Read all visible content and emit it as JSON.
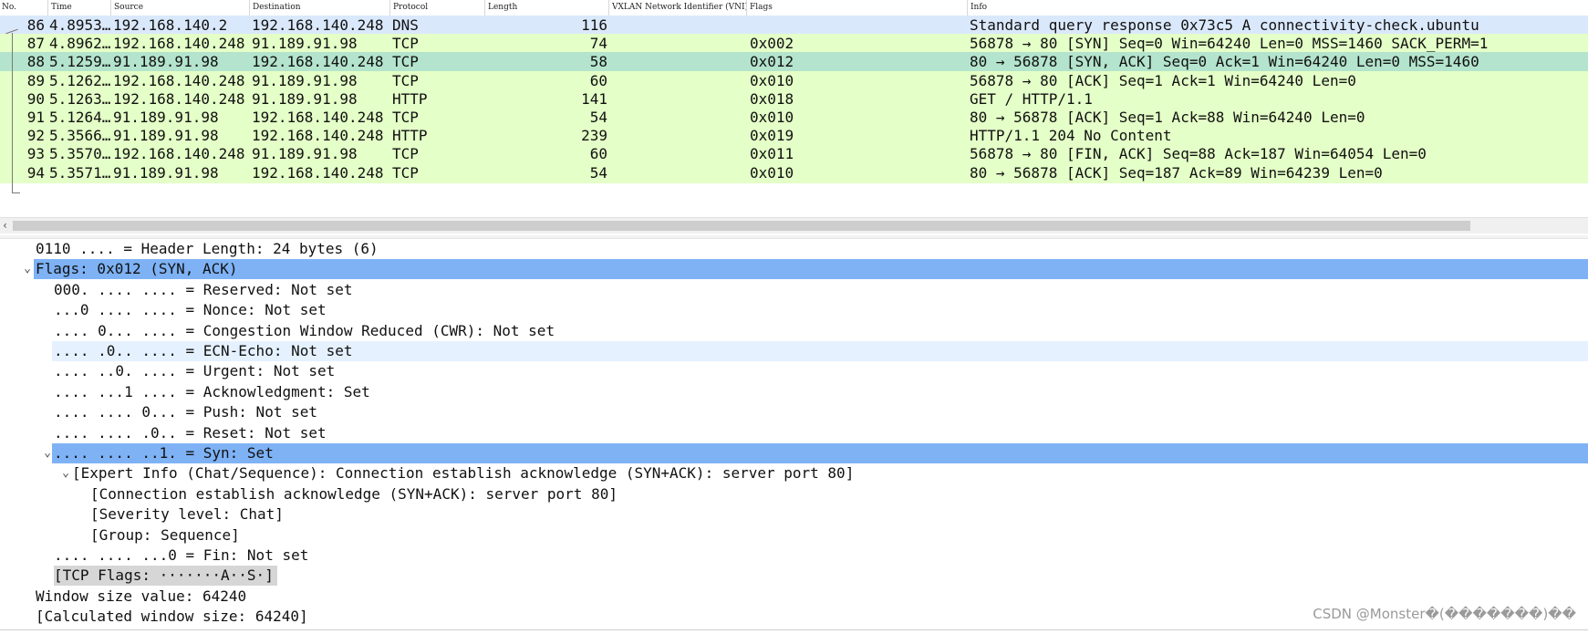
{
  "packet_list": {
    "columns": [
      "No.",
      "Time",
      "Source",
      "Destination",
      "Protocol",
      "Length",
      "VXLAN Network Identifier (VNI)",
      "Flags",
      "Info"
    ],
    "rows": [
      {
        "no": "86",
        "time": "4.8953…",
        "src": "192.168.140.2",
        "dst": "192.168.140.248",
        "proto": "DNS",
        "len": "116",
        "vni": "",
        "flags": "",
        "info": "Standard query response 0x73c5 A connectivity-check.ubuntu"
      },
      {
        "no": "87",
        "time": "4.8962…",
        "src": "192.168.140.248",
        "dst": "91.189.91.98",
        "proto": "TCP",
        "len": "74",
        "vni": "",
        "flags": "0x002",
        "info": "56878 → 80 [SYN] Seq=0 Win=64240 Len=0 MSS=1460 SACK_PERM=1"
      },
      {
        "no": "88",
        "time": "5.1259…",
        "src": "91.189.91.98",
        "dst": "192.168.140.248",
        "proto": "TCP",
        "len": "58",
        "vni": "",
        "flags": "0x012",
        "info": "80 → 56878 [SYN, ACK] Seq=0 Ack=1 Win=64240 Len=0 MSS=1460"
      },
      {
        "no": "89",
        "time": "5.1262…",
        "src": "192.168.140.248",
        "dst": "91.189.91.98",
        "proto": "TCP",
        "len": "60",
        "vni": "",
        "flags": "0x010",
        "info": "56878 → 80 [ACK] Seq=1 Ack=1 Win=64240 Len=0"
      },
      {
        "no": "90",
        "time": "5.1263…",
        "src": "192.168.140.248",
        "dst": "91.189.91.98",
        "proto": "HTTP",
        "len": "141",
        "vni": "",
        "flags": "0x018",
        "info": "GET / HTTP/1.1"
      },
      {
        "no": "91",
        "time": "5.1264…",
        "src": "91.189.91.98",
        "dst": "192.168.140.248",
        "proto": "TCP",
        "len": "54",
        "vni": "",
        "flags": "0x010",
        "info": "80 → 56878 [ACK] Seq=1 Ack=88 Win=64240 Len=0"
      },
      {
        "no": "92",
        "time": "5.3566…",
        "src": "91.189.91.98",
        "dst": "192.168.140.248",
        "proto": "HTTP",
        "len": "239",
        "vni": "",
        "flags": "0x019",
        "info": "HTTP/1.1 204 No Content"
      },
      {
        "no": "93",
        "time": "5.3570…",
        "src": "192.168.140.248",
        "dst": "91.189.91.98",
        "proto": "TCP",
        "len": "60",
        "vni": "",
        "flags": "0x011",
        "info": "56878 → 80 [FIN, ACK] Seq=88 Ack=187 Win=64054 Len=0"
      },
      {
        "no": "94",
        "time": "5.3571…",
        "src": "91.189.91.98",
        "dst": "192.168.140.248",
        "proto": "TCP",
        "len": "54",
        "vni": "",
        "flags": "0x010",
        "info": "80 → 56878 [ACK] Seq=187 Ack=89 Win=64239 Len=0"
      }
    ],
    "row_colors": {
      "dns": "#dae8fc",
      "tcp": "#e4ffc7",
      "selected": "#b4e4cd"
    }
  },
  "details": [
    {
      "text": "0110 .... = Header Length: 24 bytes (6)"
    },
    {
      "text": "Flags: 0x012 (SYN, ACK)"
    },
    {
      "text": "000. .... .... = Reserved: Not set"
    },
    {
      "text": "...0 .... .... = Nonce: Not set"
    },
    {
      "text": ".... 0... .... = Congestion Window Reduced (CWR): Not set"
    },
    {
      "text": ".... .0.. .... = ECN-Echo: Not set"
    },
    {
      "text": ".... ..0. .... = Urgent: Not set"
    },
    {
      "text": ".... ...1 .... = Acknowledgment: Set"
    },
    {
      "text": ".... .... 0... = Push: Not set"
    },
    {
      "text": ".... .... .0.. = Reset: Not set"
    },
    {
      "text": ".... .... ..1. = Syn: Set"
    },
    {
      "text": "[Expert Info (Chat/Sequence): Connection establish acknowledge (SYN+ACK): server port 80]"
    },
    {
      "text": "[Connection establish acknowledge (SYN+ACK): server port 80]"
    },
    {
      "text": "[Severity level: Chat]"
    },
    {
      "text": "[Group: Sequence]"
    },
    {
      "text": ".... .... ...0 = Fin: Not set"
    },
    {
      "text": "[TCP Flags: ·······A··S·]"
    },
    {
      "text": "Window size value: 64240"
    },
    {
      "text": "[Calculated window size: 64240]"
    }
  ],
  "highlight_colors": {
    "selected": "#7eb2f5",
    "hover": "#e5f1ff",
    "gray": "#d6d6d6"
  },
  "icons": {
    "sort": "sort-asc-icon",
    "expand": "chevron-down-icon",
    "scroll_left": "arrow-left-icon"
  },
  "watermark": "CSDN @Monster�(�������)��"
}
